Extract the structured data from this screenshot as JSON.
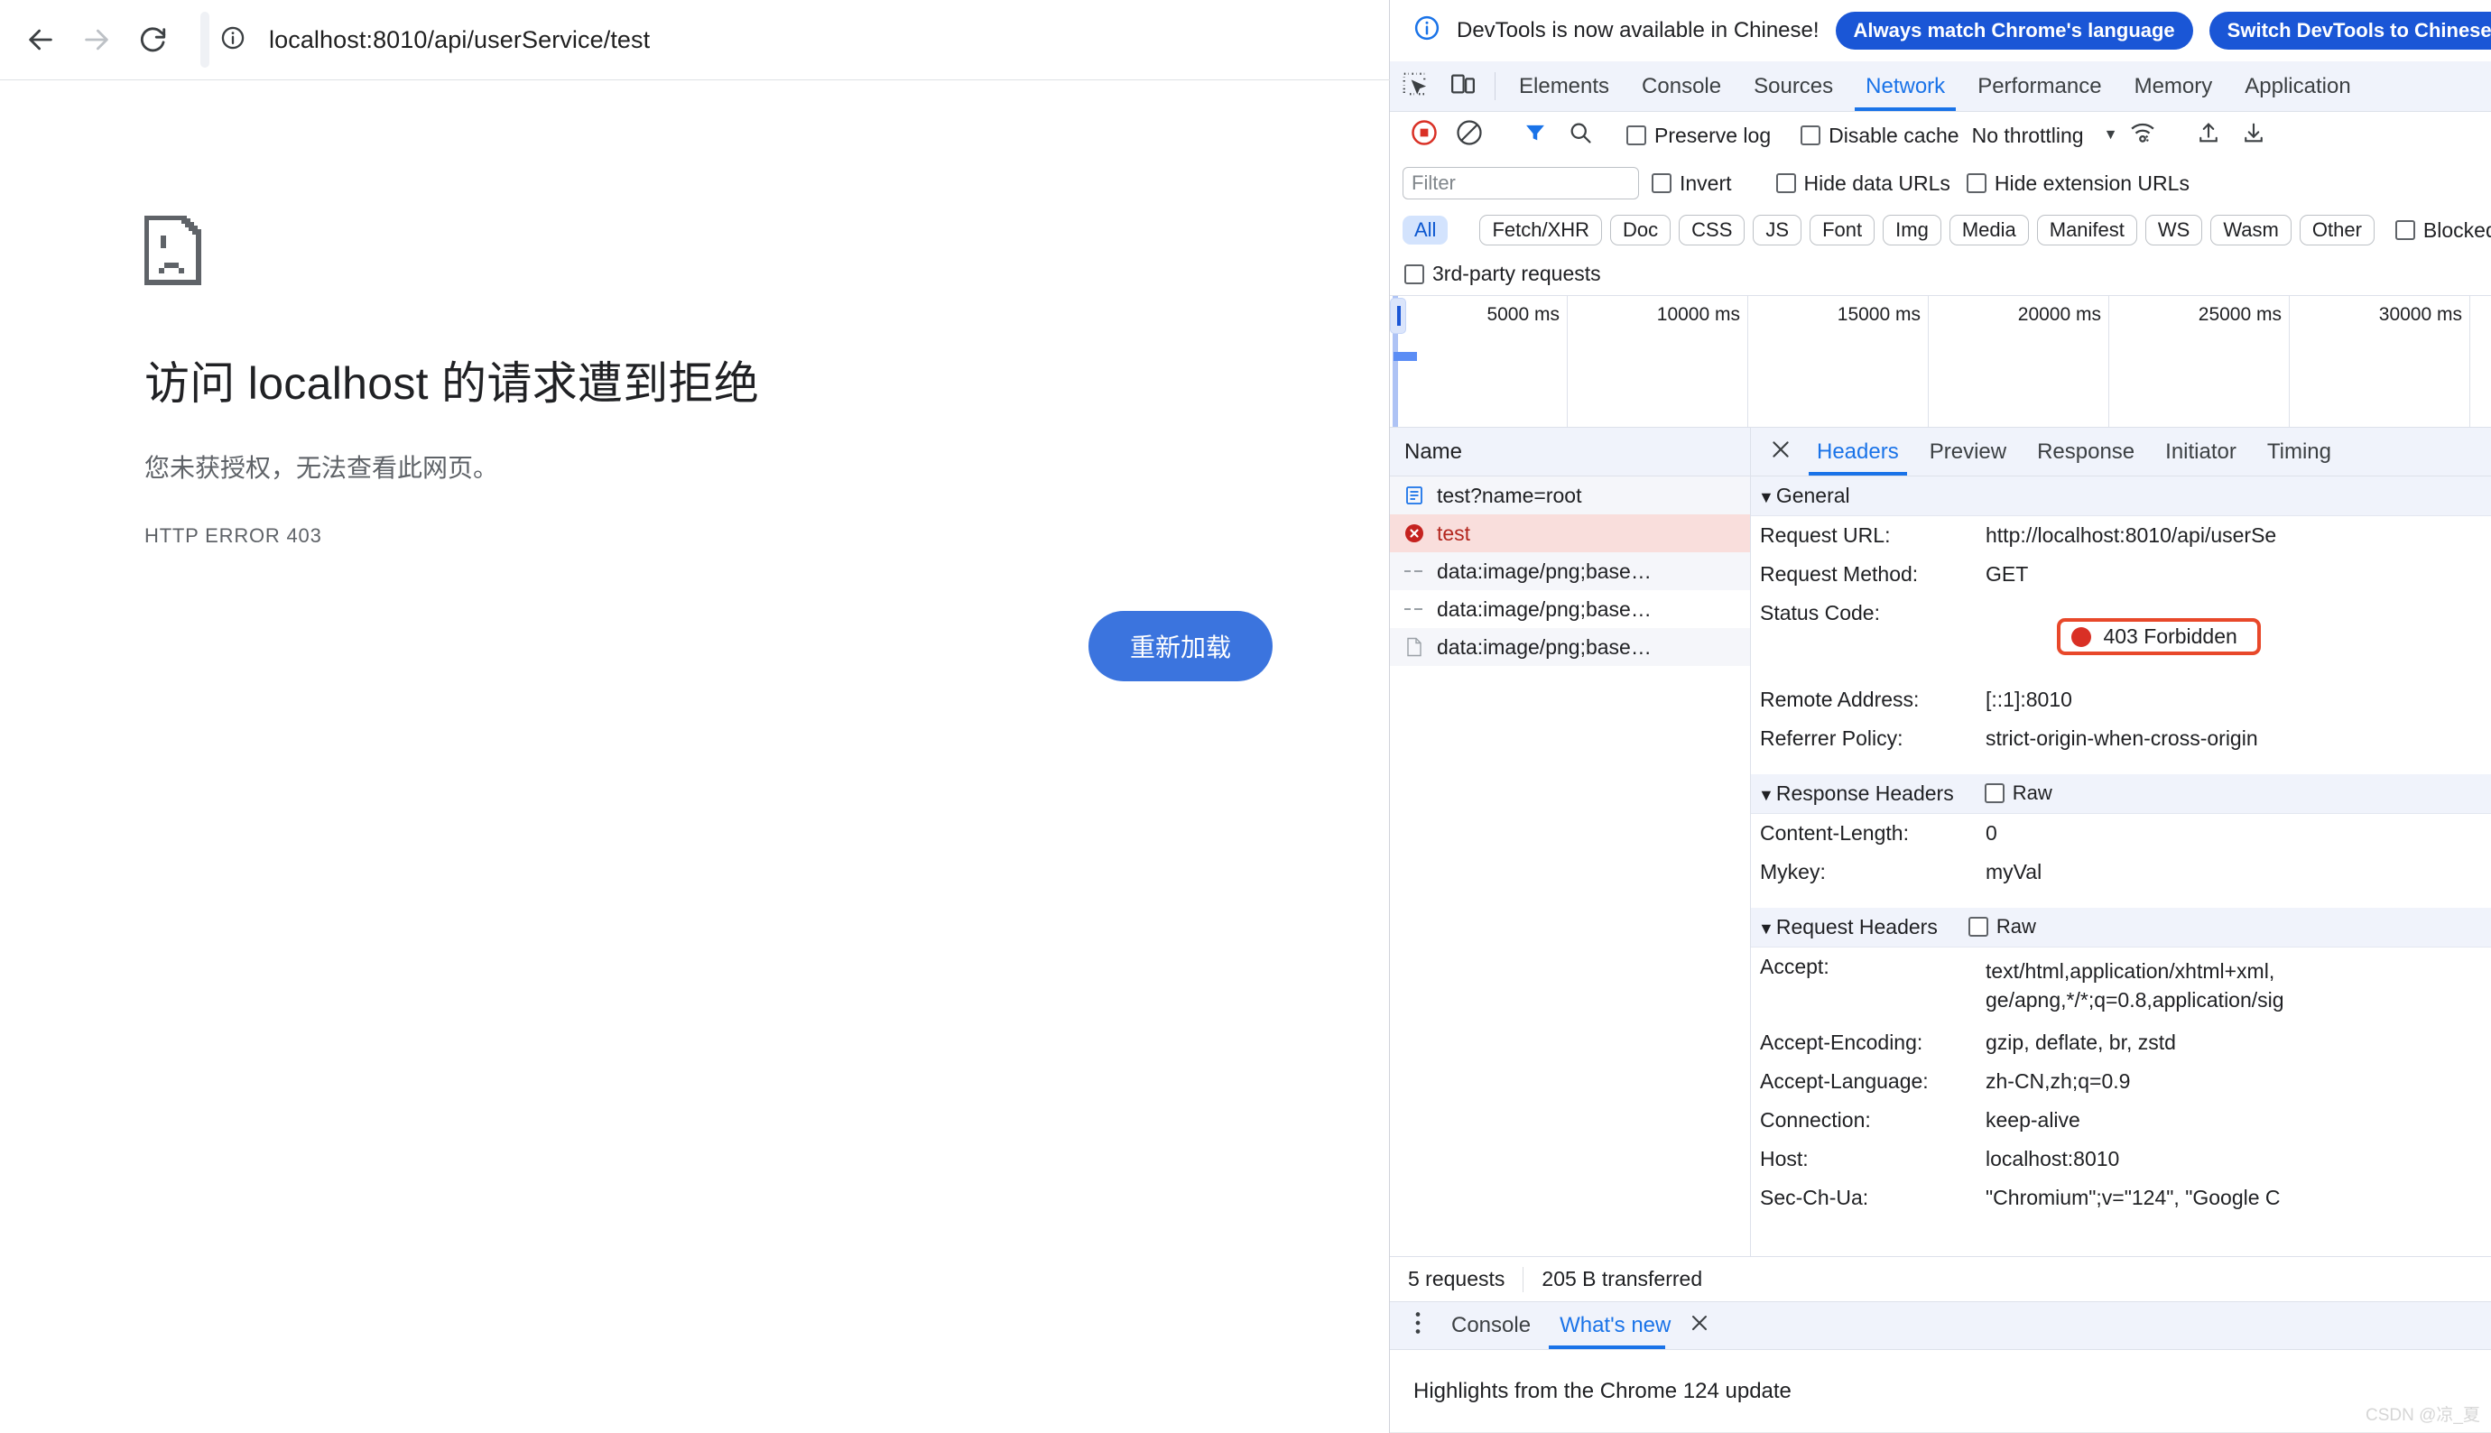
{
  "browser": {
    "nav": {
      "back_icon": "arrow-left-icon",
      "forward_icon": "arrow-right-icon",
      "reload_icon": "reload-icon"
    },
    "omnibox": {
      "site_info_icon": "info-circle-icon",
      "url": "localhost:8010/api/userService/test"
    },
    "error": {
      "icon": "sad-page-icon",
      "title": "访问 localhost 的请求遭到拒绝",
      "subtitle": "您未获授权，无法查看此网页。",
      "code": "HTTP ERROR 403",
      "reload_button": "重新加载"
    }
  },
  "devtools": {
    "notice": {
      "icon": "info-circle-icon",
      "text": "DevTools is now available in Chinese!",
      "primary_button": "Always match Chrome's language",
      "secondary_button": "Switch DevTools to Chinese"
    },
    "main_tabs": {
      "inspect_icon": "inspect-element-icon",
      "device_icon": "device-toolbar-icon",
      "items": [
        {
          "label": "Elements",
          "active": false
        },
        {
          "label": "Console",
          "active": false
        },
        {
          "label": "Sources",
          "active": false
        },
        {
          "label": "Network",
          "active": true
        },
        {
          "label": "Performance",
          "active": false
        },
        {
          "label": "Memory",
          "active": false
        },
        {
          "label": "Application",
          "active": false
        }
      ]
    },
    "network_toolbar": {
      "record_icon": "record-stop-icon",
      "clear_icon": "clear-icon",
      "filter_icon": "filter-funnel-icon",
      "search_icon": "search-icon",
      "preserve_log": "Preserve log",
      "disable_cache": "Disable cache",
      "throttling": "No throttling",
      "throttling_caret": "chevron-down-icon",
      "wifi_icon": "network-conditions-icon",
      "import_icon": "import-har-icon",
      "export_icon": "export-har-icon"
    },
    "filter_row": {
      "placeholder": "Filter",
      "value": "",
      "invert": "Invert",
      "hide_data_urls": "Hide data URLs",
      "hide_extension_urls": "Hide extension URLs"
    },
    "type_filters": [
      {
        "label": "All",
        "selected": true
      },
      {
        "label": "Fetch/XHR",
        "selected": false
      },
      {
        "label": "Doc",
        "selected": false
      },
      {
        "label": "CSS",
        "selected": false
      },
      {
        "label": "JS",
        "selected": false
      },
      {
        "label": "Font",
        "selected": false
      },
      {
        "label": "Img",
        "selected": false
      },
      {
        "label": "Media",
        "selected": false
      },
      {
        "label": "Manifest",
        "selected": false
      },
      {
        "label": "WS",
        "selected": false
      },
      {
        "label": "Wasm",
        "selected": false
      },
      {
        "label": "Other",
        "selected": false
      }
    ],
    "blocked_label": "Blocked r",
    "third_party": "3rd-party requests",
    "overview": {
      "ticks": [
        "5000 ms",
        "10000 ms",
        "15000 ms",
        "20000 ms",
        "25000 ms",
        "30000 ms"
      ]
    },
    "request_table": {
      "column_header": "Name",
      "rows": [
        {
          "name": "test?name=root",
          "icon": "document-icon",
          "state": "normal"
        },
        {
          "name": "test",
          "icon": "error-circle-icon",
          "state": "error"
        },
        {
          "name": "data:image/png;base…",
          "icon": "dash-icon",
          "state": "normal"
        },
        {
          "name": "data:image/png;base…",
          "icon": "dash-icon",
          "state": "normal"
        },
        {
          "name": "data:image/png;base…",
          "icon": "file-icon",
          "state": "normal"
        }
      ]
    },
    "detail_tabs": {
      "close_icon": "close-icon",
      "items": [
        {
          "label": "Headers",
          "active": true
        },
        {
          "label": "Preview",
          "active": false
        },
        {
          "label": "Response",
          "active": false
        },
        {
          "label": "Initiator",
          "active": false
        },
        {
          "label": "Timing",
          "active": false
        }
      ]
    },
    "sections": [
      {
        "title": "General",
        "raw_label": null,
        "rows": [
          {
            "key": "Request URL:",
            "value": "http://localhost:8010/api/userSe",
            "highlight": false
          },
          {
            "key": "Request Method:",
            "value": "GET",
            "highlight": false
          },
          {
            "key": "Status Code:",
            "value": "403 Forbidden",
            "highlight": true
          },
          {
            "key": "Remote Address:",
            "value": "[::1]:8010",
            "highlight": false
          },
          {
            "key": "Referrer Policy:",
            "value": "strict-origin-when-cross-origin",
            "highlight": false
          }
        ]
      },
      {
        "title": "Response Headers",
        "raw_label": "Raw",
        "rows": [
          {
            "key": "Content-Length:",
            "value": "0",
            "highlight": false
          },
          {
            "key": "Mykey:",
            "value": "myVal",
            "highlight": false
          }
        ]
      },
      {
        "title": "Request Headers",
        "raw_label": "Raw",
        "rows": [
          {
            "key": "Accept:",
            "value": "text/html,application/xhtml+xml,\nge/apng,*/*;q=0.8,application/sig",
            "highlight": false
          },
          {
            "key": "Accept-Encoding:",
            "value": "gzip, deflate, br, zstd",
            "highlight": false
          },
          {
            "key": "Accept-Language:",
            "value": "zh-CN,zh;q=0.9",
            "highlight": false
          },
          {
            "key": "Connection:",
            "value": "keep-alive",
            "highlight": false
          },
          {
            "key": "Host:",
            "value": "localhost:8010",
            "highlight": false
          },
          {
            "key": "Sec-Ch-Ua:",
            "value": "\"Chromium\";v=\"124\", \"Google C",
            "highlight": false
          }
        ]
      }
    ],
    "status_bar": {
      "requests": "5 requests",
      "transferred": "205 B transferred"
    },
    "drawer": {
      "kebab_icon": "more-options-icon",
      "tabs": [
        {
          "label": "Console",
          "active": false
        },
        {
          "label": "What's new",
          "active": true
        }
      ],
      "close_icon": "close-icon",
      "content": "Highlights from the Chrome 124 update"
    }
  },
  "watermark": "CSDN @凉_夏"
}
